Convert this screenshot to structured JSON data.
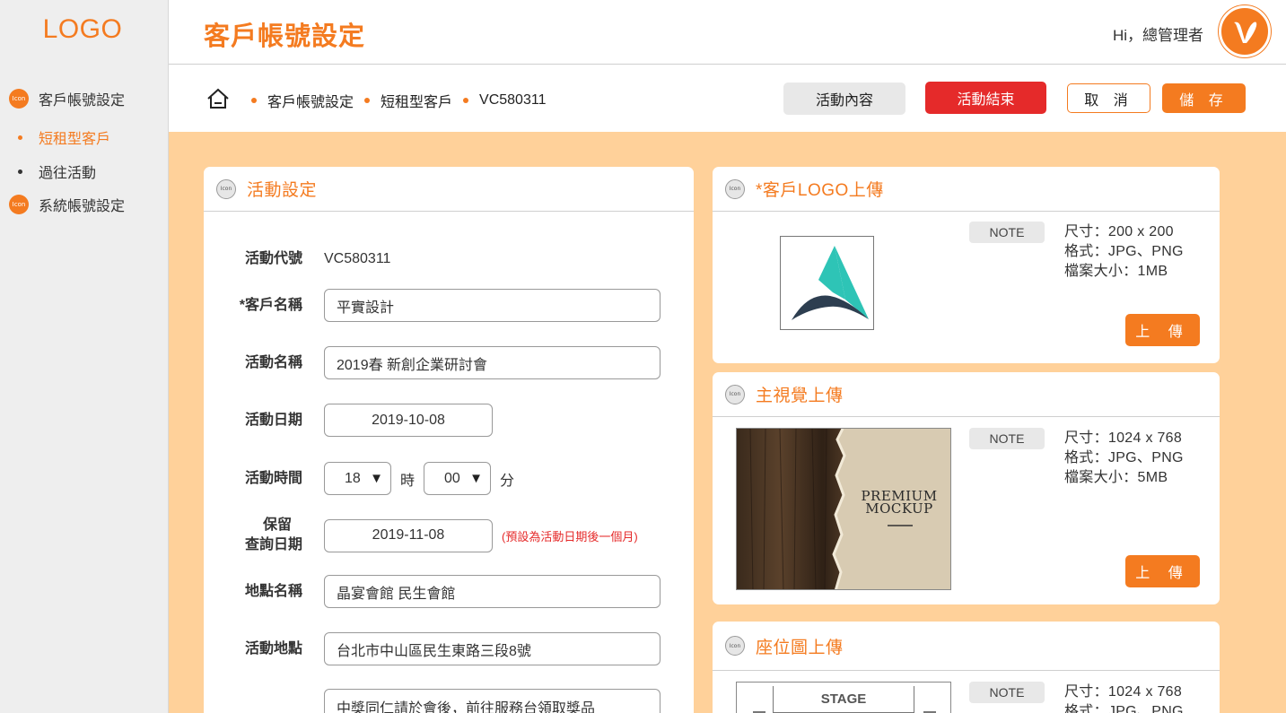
{
  "sidebar": {
    "logo": "LOGO",
    "icon_text": "Icon",
    "items": [
      {
        "label": "客戶帳號設定"
      },
      {
        "label": "短租型客戶"
      },
      {
        "label": "過往活動"
      },
      {
        "label": "系統帳號設定"
      }
    ]
  },
  "header": {
    "title": "客戶帳號設定",
    "greeting": "Hi，總管理者"
  },
  "breadcrumb": [
    "客戶帳號設定",
    "短租型客戶",
    "VC580311"
  ],
  "actions": {
    "content": "活動內容",
    "end": "活動結束",
    "cancel": "取 消",
    "save": "儲 存"
  },
  "settings": {
    "title": "活動設定",
    "icon_text": "Icon",
    "fields": {
      "code_label": "活動代號",
      "code_value": "VC580311",
      "client_label": "*客戶名稱",
      "client_value": "平實設計",
      "name_label": "活動名稱",
      "name_value": "2019春 新創企業研討會",
      "date_label": "活動日期",
      "date_value": "2019-10-08",
      "time_label": "活動時間",
      "hour_value": "18",
      "hour_unit": "時",
      "minute_value": "00",
      "minute_unit": "分",
      "keep_label_1": "保留",
      "keep_label_2": "查詢日期",
      "keep_value": "2019-11-08",
      "keep_hint": "(預設為活動日期後一個月)",
      "venue_label": "地點名稱",
      "venue_value": "晶宴會館 民生會館",
      "address_label": "活動地點",
      "address_value": "台北市中山區民生東路三段8號",
      "note_value": "中獎同仁請於會後，前往服務台領取獎品"
    }
  },
  "uploads": [
    {
      "title": "*客戶LOGO上傳",
      "note": "NOTE",
      "size": "尺寸：200 x 200",
      "format": "格式：JPG、PNG",
      "filesize": "檔案大小：1MB",
      "button": "上 傳"
    },
    {
      "title": "主視覺上傳",
      "note": "NOTE",
      "size": "尺寸：1024 x 768",
      "format": "格式：JPG、PNG",
      "filesize": "檔案大小：5MB",
      "button": "上 傳",
      "image_text_1": "PREMIUM",
      "image_text_2": "MOCKUP"
    },
    {
      "title": "座位圖上傳",
      "note": "NOTE",
      "size": "尺寸：1024 x 768",
      "format": "格式：JPG、PNG",
      "stage": "STAGE"
    }
  ],
  "colors": {
    "accent": "#f47b20",
    "danger": "#e52a2a",
    "content_bg": "#ffd19a",
    "sidebar_bg": "#eeeeee"
  }
}
